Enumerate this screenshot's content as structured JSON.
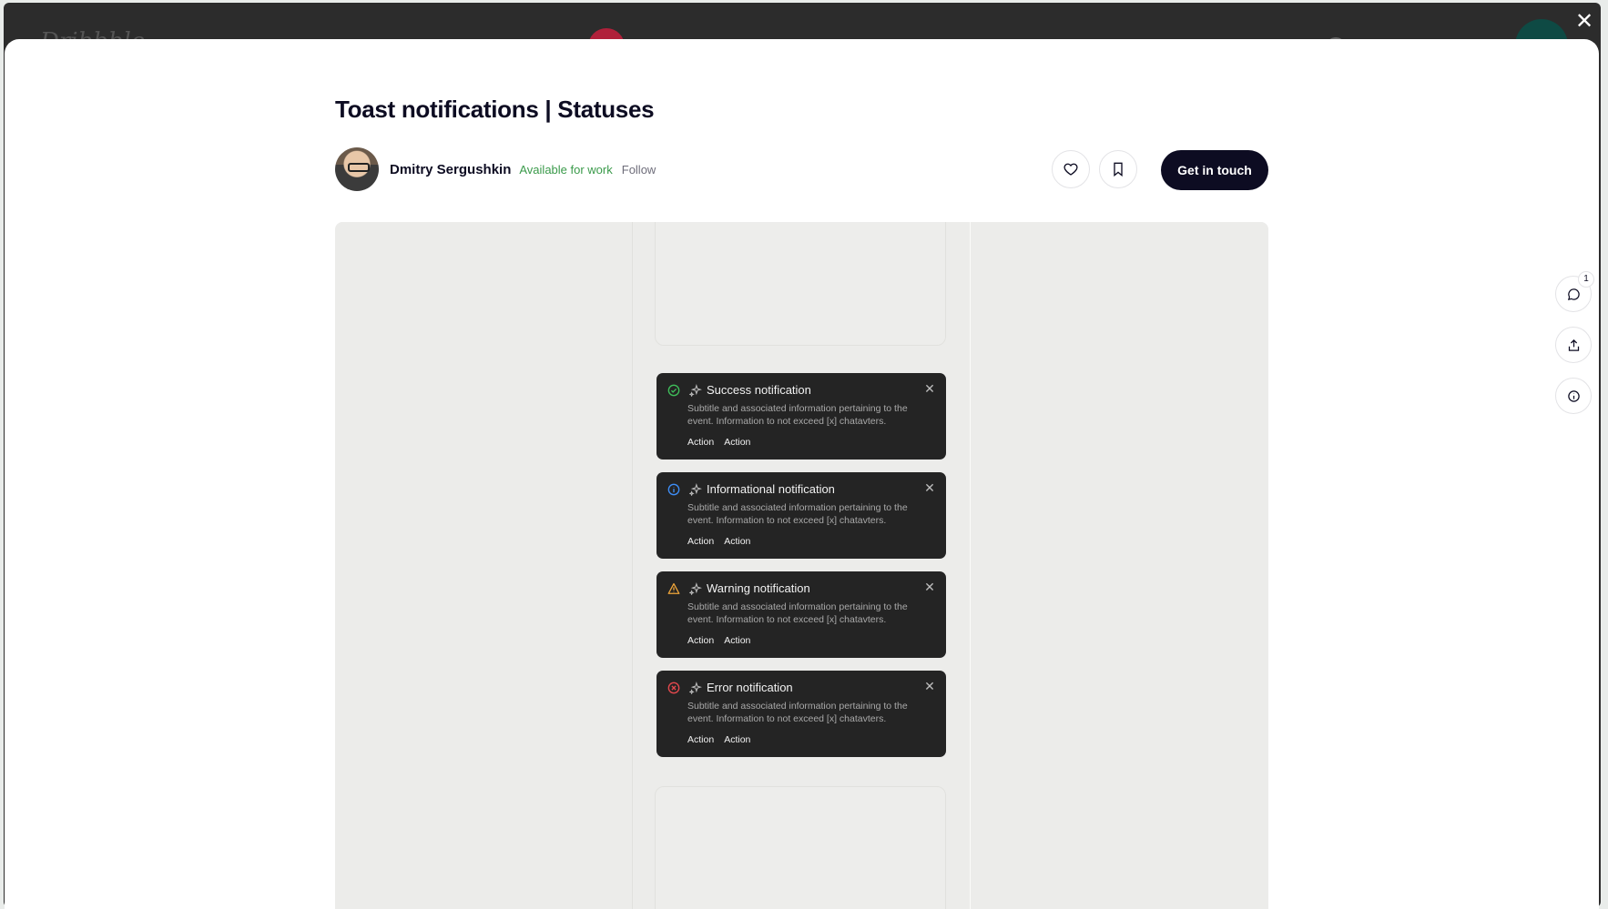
{
  "background": {
    "logo_text": "Dribbble"
  },
  "modal": {
    "close_label": "✕",
    "title": "Toast notifications | Statuses",
    "author": {
      "name": "Dmitry Sergushkin",
      "availability": "Available for work",
      "follow_label": "Follow"
    },
    "actions": {
      "like_icon": "heart-icon",
      "save_icon": "bookmark-icon",
      "cta_label": "Get in touch"
    },
    "side_actions": {
      "comments_count": "1",
      "comment_icon": "comment-icon",
      "share_icon": "share-icon",
      "info_icon": "info-icon"
    }
  },
  "toasts": [
    {
      "status": "success",
      "status_color": "#3fbf5a",
      "title": "Success notification",
      "body": "Subtitle and associated information pertaining to the event. Information to not exceed [x] chatavters.",
      "action1": "Action",
      "action2": "Action"
    },
    {
      "status": "info",
      "status_color": "#3e8ef7",
      "title": "Informational notification",
      "body": "Subtitle and associated information pertaining to the event. Information to not exceed [x] chatavters.",
      "action1": "Action",
      "action2": "Action"
    },
    {
      "status": "warning",
      "status_color": "#f0a63a",
      "title": "Warning notification",
      "body": "Subtitle and associated information pertaining to the event. Information to not exceed [x] chatavters.",
      "action1": "Action",
      "action2": "Action"
    },
    {
      "status": "error",
      "status_color": "#e5484d",
      "title": "Error notification",
      "body": "Subtitle and associated information pertaining to the event. Information to not exceed [x] chatavters.",
      "action1": "Action",
      "action2": "Action"
    }
  ]
}
